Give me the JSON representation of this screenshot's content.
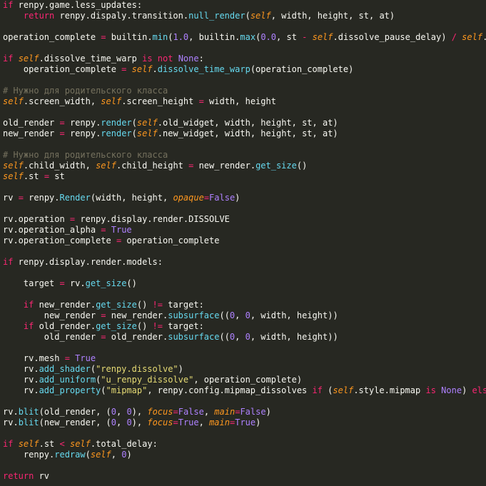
{
  "editor": {
    "background": "#272822",
    "token_colors": {
      "keyword": "#f92672",
      "operator": "#f92672",
      "function": "#66d9ef",
      "self": "#fd971f",
      "number": "#ae81ff",
      "string": "#e6db74",
      "comment": "#75715e",
      "plain": "#f8f8f2"
    },
    "lines": [
      [
        [
          "kw",
          "if"
        ],
        [
          "pl",
          " renpy.game.less_updates:"
        ]
      ],
      [
        [
          "pl",
          "    "
        ],
        [
          "kw",
          "return"
        ],
        [
          "pl",
          " renpy.dispaly.transition."
        ],
        [
          "fn",
          "null_render"
        ],
        [
          "pl",
          "("
        ],
        [
          "sf",
          "self"
        ],
        [
          "pl",
          ", width, height, st, at)"
        ]
      ],
      [],
      [
        [
          "pl",
          "operation_complete "
        ],
        [
          "op",
          "="
        ],
        [
          "pl",
          " builtin."
        ],
        [
          "fn",
          "min"
        ],
        [
          "pl",
          "("
        ],
        [
          "num",
          "1.0"
        ],
        [
          "pl",
          ", builtin."
        ],
        [
          "fn",
          "max"
        ],
        [
          "pl",
          "("
        ],
        [
          "num",
          "0.0"
        ],
        [
          "pl",
          ", st "
        ],
        [
          "op",
          "-"
        ],
        [
          "pl",
          " "
        ],
        [
          "sf",
          "self"
        ],
        [
          "pl",
          ".dissolve_pause_delay) "
        ],
        [
          "op",
          "/"
        ],
        [
          "pl",
          " "
        ],
        [
          "sf",
          "self"
        ],
        [
          "pl",
          ".d"
        ]
      ],
      [],
      [
        [
          "kw",
          "if"
        ],
        [
          "pl",
          " "
        ],
        [
          "sf",
          "self"
        ],
        [
          "pl",
          ".dissolve_time_warp "
        ],
        [
          "kw",
          "is not"
        ],
        [
          "pl",
          " "
        ],
        [
          "num",
          "None"
        ],
        [
          "pl",
          ":"
        ]
      ],
      [
        [
          "pl",
          "    operation_complete "
        ],
        [
          "op",
          "="
        ],
        [
          "pl",
          " "
        ],
        [
          "sf",
          "self"
        ],
        [
          "pl",
          "."
        ],
        [
          "fn",
          "dissolve_time_warp"
        ],
        [
          "pl",
          "(operation_complete)"
        ]
      ],
      [],
      [
        [
          "cm",
          "# Нужно для родительского класса"
        ]
      ],
      [
        [
          "sf",
          "self"
        ],
        [
          "pl",
          ".screen_width, "
        ],
        [
          "sf",
          "self"
        ],
        [
          "pl",
          ".screen_height "
        ],
        [
          "op",
          "="
        ],
        [
          "pl",
          " width, height"
        ]
      ],
      [],
      [
        [
          "pl",
          "old_render "
        ],
        [
          "op",
          "="
        ],
        [
          "pl",
          " renpy."
        ],
        [
          "fn",
          "render"
        ],
        [
          "pl",
          "("
        ],
        [
          "sf",
          "self"
        ],
        [
          "pl",
          ".old_widget, width, height, st, at)"
        ]
      ],
      [
        [
          "pl",
          "new_render "
        ],
        [
          "op",
          "="
        ],
        [
          "pl",
          " renpy."
        ],
        [
          "fn",
          "render"
        ],
        [
          "pl",
          "("
        ],
        [
          "sf",
          "self"
        ],
        [
          "pl",
          ".new_widget, width, height, st, at)"
        ]
      ],
      [],
      [
        [
          "cm",
          "# Нужно для родительского класса"
        ]
      ],
      [
        [
          "sf",
          "self"
        ],
        [
          "pl",
          ".child_width, "
        ],
        [
          "sf",
          "self"
        ],
        [
          "pl",
          ".child_height "
        ],
        [
          "op",
          "="
        ],
        [
          "pl",
          " new_render."
        ],
        [
          "fn",
          "get_size"
        ],
        [
          "pl",
          "()"
        ]
      ],
      [
        [
          "sf",
          "self"
        ],
        [
          "pl",
          ".st "
        ],
        [
          "op",
          "="
        ],
        [
          "pl",
          " st"
        ]
      ],
      [],
      [
        [
          "pl",
          "rv "
        ],
        [
          "op",
          "="
        ],
        [
          "pl",
          " renpy."
        ],
        [
          "fn",
          "Render"
        ],
        [
          "pl",
          "(width, height, "
        ],
        [
          "sf",
          "opaque"
        ],
        [
          "op",
          "="
        ],
        [
          "num",
          "False"
        ],
        [
          "pl",
          ")"
        ]
      ],
      [],
      [
        [
          "pl",
          "rv.operation "
        ],
        [
          "op",
          "="
        ],
        [
          "pl",
          " renpy.display.render.DISSOLVE"
        ]
      ],
      [
        [
          "pl",
          "rv.operation_alpha "
        ],
        [
          "op",
          "="
        ],
        [
          "pl",
          " "
        ],
        [
          "num",
          "True"
        ]
      ],
      [
        [
          "pl",
          "rv.operation_complete "
        ],
        [
          "op",
          "="
        ],
        [
          "pl",
          " operation_complete"
        ]
      ],
      [],
      [
        [
          "kw",
          "if"
        ],
        [
          "pl",
          " renpy.display.render.models:"
        ]
      ],
      [],
      [
        [
          "pl",
          "    target "
        ],
        [
          "op",
          "="
        ],
        [
          "pl",
          " rv."
        ],
        [
          "fn",
          "get_size"
        ],
        [
          "pl",
          "()"
        ]
      ],
      [],
      [
        [
          "pl",
          "    "
        ],
        [
          "kw",
          "if"
        ],
        [
          "pl",
          " new_render."
        ],
        [
          "fn",
          "get_size"
        ],
        [
          "pl",
          "() "
        ],
        [
          "op",
          "!="
        ],
        [
          "pl",
          " target:"
        ]
      ],
      [
        [
          "pl",
          "        new_render "
        ],
        [
          "op",
          "="
        ],
        [
          "pl",
          " new_render."
        ],
        [
          "fn",
          "subsurface"
        ],
        [
          "pl",
          "(("
        ],
        [
          "num",
          "0"
        ],
        [
          "pl",
          ", "
        ],
        [
          "num",
          "0"
        ],
        [
          "pl",
          ", width, height))"
        ]
      ],
      [
        [
          "pl",
          "    "
        ],
        [
          "kw",
          "if"
        ],
        [
          "pl",
          " old_render."
        ],
        [
          "fn",
          "get_size"
        ],
        [
          "pl",
          "() "
        ],
        [
          "op",
          "!="
        ],
        [
          "pl",
          " target:"
        ]
      ],
      [
        [
          "pl",
          "        old_render "
        ],
        [
          "op",
          "="
        ],
        [
          "pl",
          " old_render."
        ],
        [
          "fn",
          "subsurface"
        ],
        [
          "pl",
          "(("
        ],
        [
          "num",
          "0"
        ],
        [
          "pl",
          ", "
        ],
        [
          "num",
          "0"
        ],
        [
          "pl",
          ", width, height))"
        ]
      ],
      [],
      [
        [
          "pl",
          "    rv.mesh "
        ],
        [
          "op",
          "="
        ],
        [
          "pl",
          " "
        ],
        [
          "num",
          "True"
        ]
      ],
      [
        [
          "pl",
          "    rv."
        ],
        [
          "fn",
          "add_shader"
        ],
        [
          "pl",
          "("
        ],
        [
          "str",
          "\"renpy.dissolve\""
        ],
        [
          "pl",
          ")"
        ]
      ],
      [
        [
          "pl",
          "    rv."
        ],
        [
          "fn",
          "add_uniform"
        ],
        [
          "pl",
          "("
        ],
        [
          "str",
          "\"u_renpy_dissolve\""
        ],
        [
          "pl",
          ", operation_complete)"
        ]
      ],
      [
        [
          "pl",
          "    rv."
        ],
        [
          "fn",
          "add_property"
        ],
        [
          "pl",
          "("
        ],
        [
          "str",
          "\"mipmap\""
        ],
        [
          "pl",
          ", renpy.config.mipmap_dissolves "
        ],
        [
          "kw",
          "if"
        ],
        [
          "pl",
          " ("
        ],
        [
          "sf",
          "self"
        ],
        [
          "pl",
          ".style.mipmap "
        ],
        [
          "kw",
          "is"
        ],
        [
          "pl",
          " "
        ],
        [
          "num",
          "None"
        ],
        [
          "pl",
          ") "
        ],
        [
          "kw",
          "else"
        ]
      ],
      [],
      [
        [
          "pl",
          "rv."
        ],
        [
          "fn",
          "blit"
        ],
        [
          "pl",
          "(old_render, ("
        ],
        [
          "num",
          "0"
        ],
        [
          "pl",
          ", "
        ],
        [
          "num",
          "0"
        ],
        [
          "pl",
          "), "
        ],
        [
          "sf",
          "focus"
        ],
        [
          "op",
          "="
        ],
        [
          "num",
          "False"
        ],
        [
          "pl",
          ", "
        ],
        [
          "sf",
          "main"
        ],
        [
          "op",
          "="
        ],
        [
          "num",
          "False"
        ],
        [
          "pl",
          ")"
        ]
      ],
      [
        [
          "pl",
          "rv."
        ],
        [
          "fn",
          "blit"
        ],
        [
          "pl",
          "(new_render, ("
        ],
        [
          "num",
          "0"
        ],
        [
          "pl",
          ", "
        ],
        [
          "num",
          "0"
        ],
        [
          "pl",
          "), "
        ],
        [
          "sf",
          "focus"
        ],
        [
          "op",
          "="
        ],
        [
          "num",
          "True"
        ],
        [
          "pl",
          ", "
        ],
        [
          "sf",
          "main"
        ],
        [
          "op",
          "="
        ],
        [
          "num",
          "True"
        ],
        [
          "pl",
          ")"
        ]
      ],
      [],
      [
        [
          "kw",
          "if"
        ],
        [
          "pl",
          " "
        ],
        [
          "sf",
          "self"
        ],
        [
          "pl",
          ".st "
        ],
        [
          "op",
          "<"
        ],
        [
          "pl",
          " "
        ],
        [
          "sf",
          "self"
        ],
        [
          "pl",
          ".total_delay:"
        ]
      ],
      [
        [
          "pl",
          "    renpy."
        ],
        [
          "fn",
          "redraw"
        ],
        [
          "pl",
          "("
        ],
        [
          "sf",
          "self"
        ],
        [
          "pl",
          ", "
        ],
        [
          "num",
          "0"
        ],
        [
          "pl",
          ")"
        ]
      ],
      [],
      [
        [
          "kw",
          "return"
        ],
        [
          "pl",
          " rv"
        ]
      ]
    ]
  }
}
